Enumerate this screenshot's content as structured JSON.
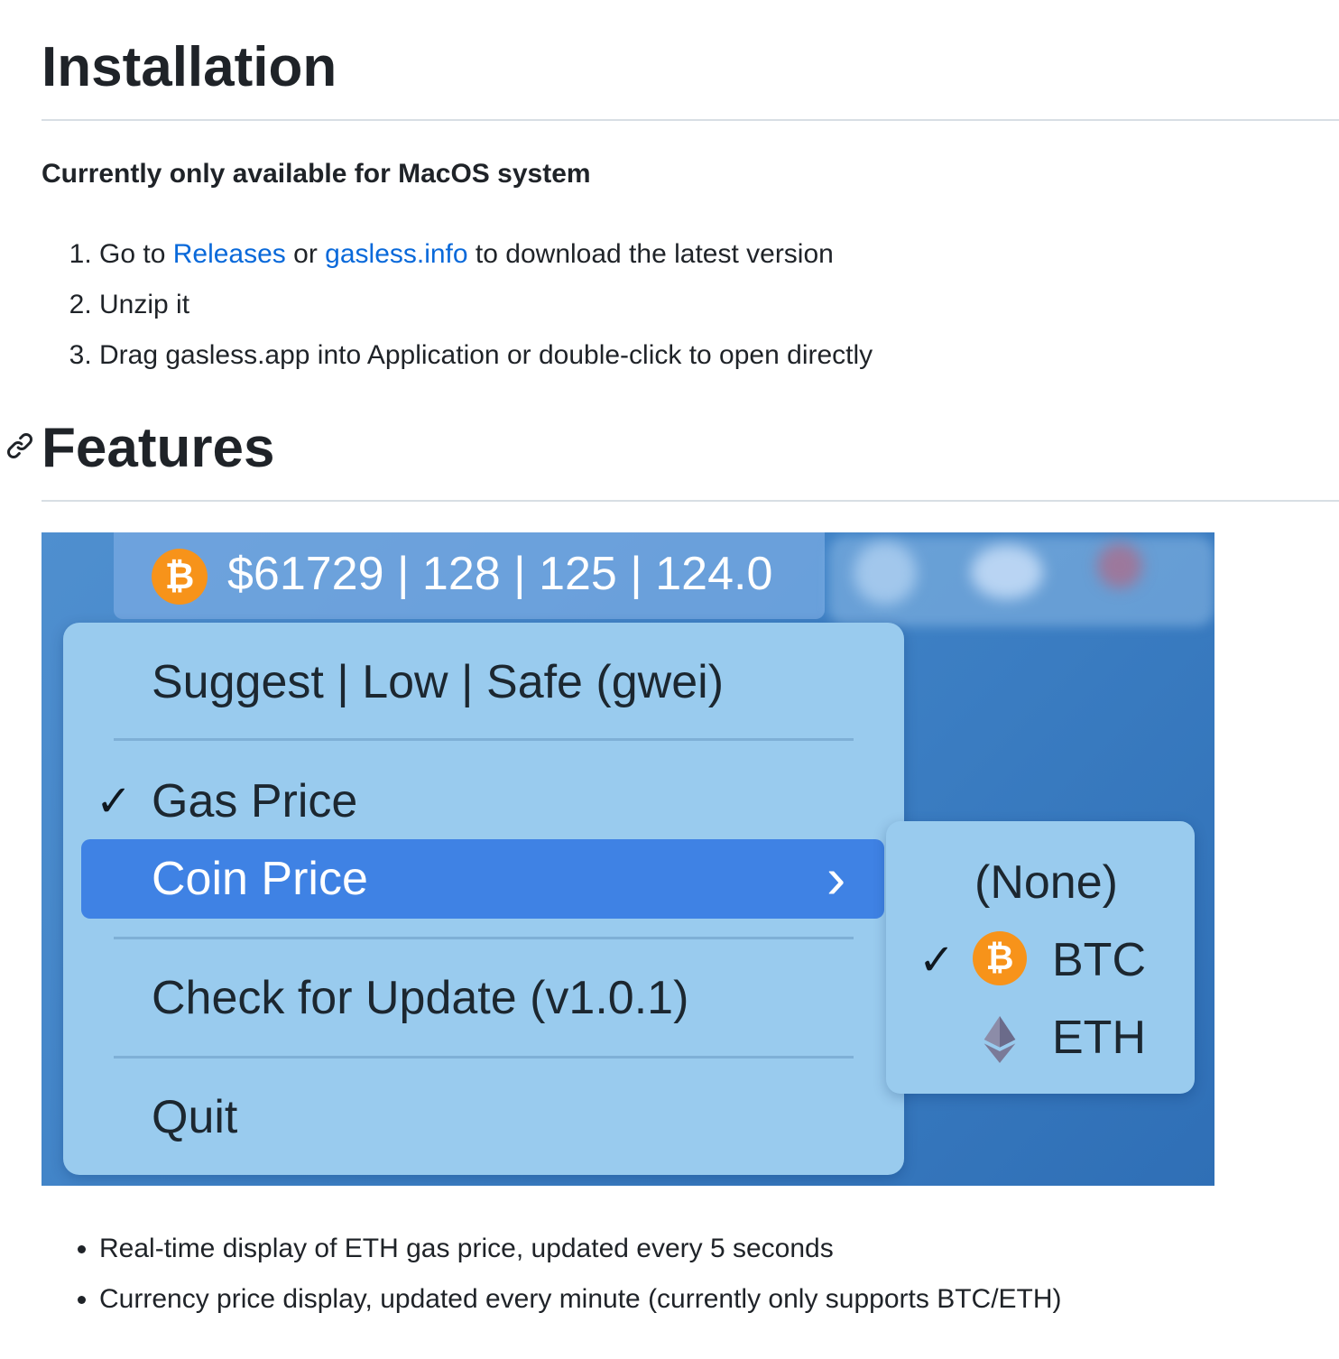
{
  "installation": {
    "title": "Installation",
    "subtitle": "Currently only available for MacOS system",
    "steps": {
      "step1": {
        "prefix": "Go to ",
        "link1": "Releases",
        "mid": " or ",
        "link2": "gasless.info",
        "suffix": " to download the latest version"
      },
      "step2": "Unzip it",
      "step3": "Drag gasless.app into Application or double-click to open directly"
    }
  },
  "features": {
    "title": "Features",
    "bullets": [
      "Real-time display of ETH gas price, updated every 5 seconds",
      "Currency price display, updated every minute (currently only supports BTC/ETH)"
    ]
  },
  "screenshot": {
    "menubar_text": "$61729 | 128 | 125 | 124.0",
    "coin_symbol": "₿",
    "menu": {
      "header": "Suggest | Low | Safe (gwei)",
      "gas_price": "Gas Price",
      "coin_price": "Coin Price",
      "check_update": "Check for Update (v1.0.1)",
      "quit": "Quit",
      "check_mark": "✓",
      "submenu_arrow": "›"
    },
    "submenu": {
      "none": "(None)",
      "btc": "BTC",
      "eth": "ETH",
      "check_mark": "✓"
    }
  },
  "colors": {
    "link": "#0969da",
    "highlight": "#3f82e4",
    "btc_orange": "#f7931a"
  }
}
